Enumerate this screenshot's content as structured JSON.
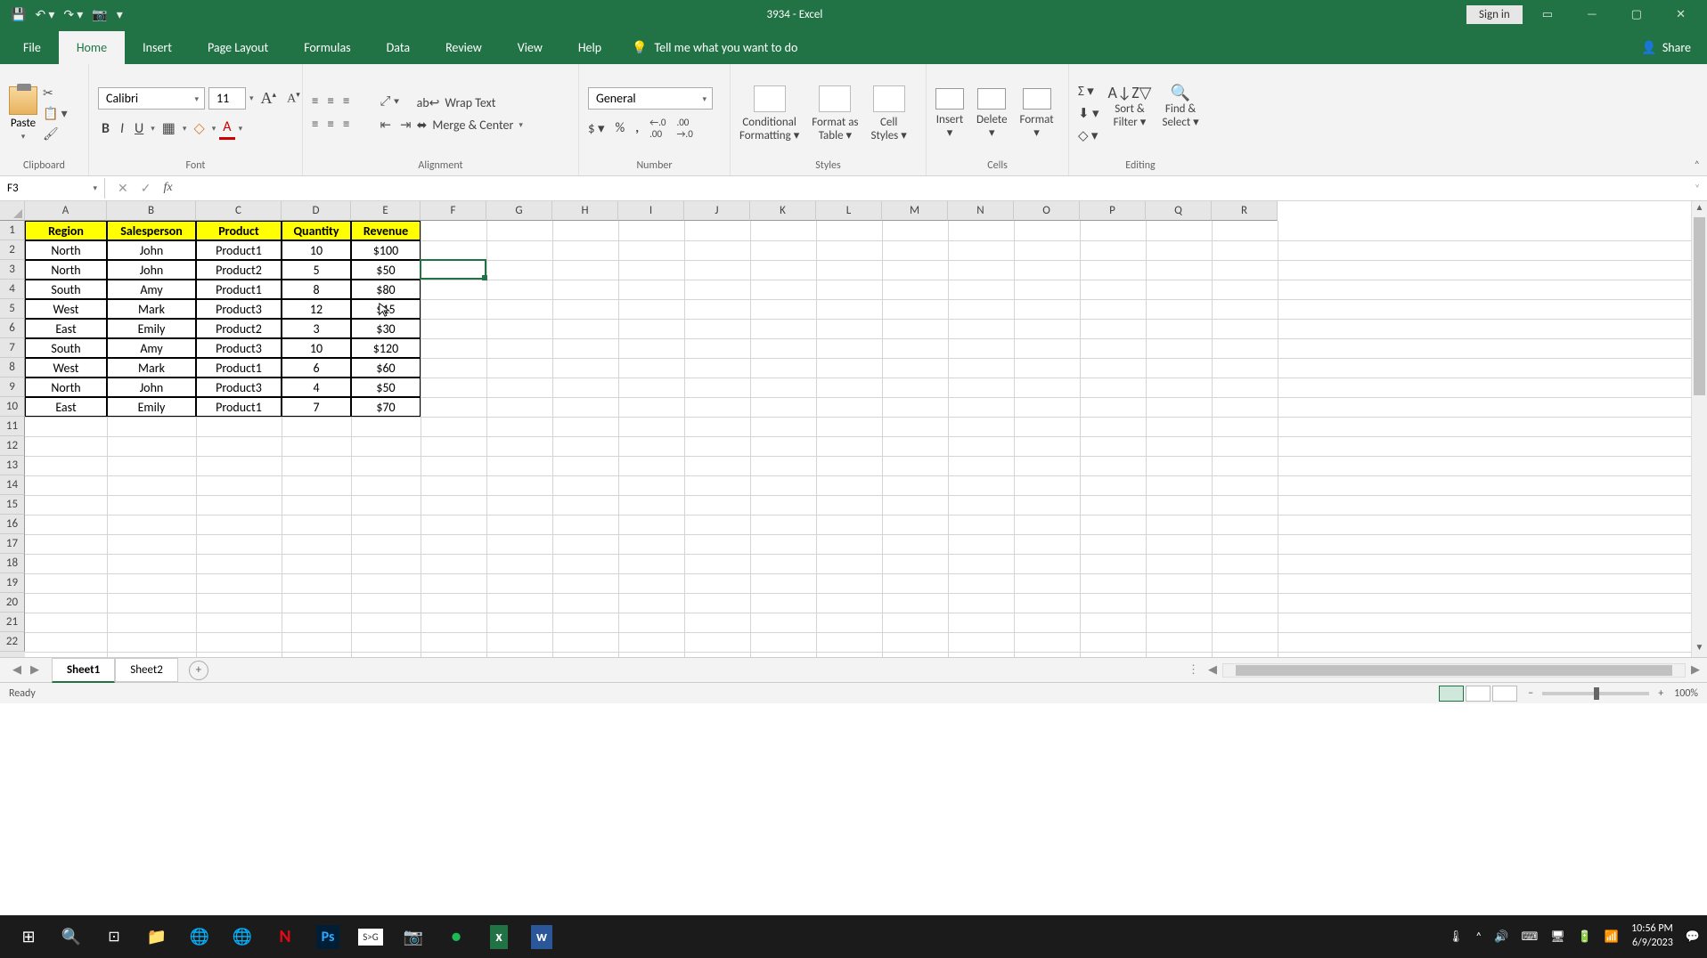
{
  "app": {
    "title": "3934  -  Excel",
    "signin": "Sign in"
  },
  "tabs": {
    "file": "File",
    "list": [
      "Home",
      "Insert",
      "Page Layout",
      "Formulas",
      "Data",
      "Review",
      "View",
      "Help"
    ],
    "active": "Home",
    "tellme": "Tell me what you want to do",
    "share": "Share"
  },
  "ribbon": {
    "clipboard": {
      "label": "Clipboard",
      "paste": "Paste"
    },
    "font": {
      "label": "Font",
      "name": "Calibri",
      "size": "11"
    },
    "alignment": {
      "label": "Alignment",
      "wrap": "Wrap Text",
      "merge": "Merge & Center"
    },
    "number": {
      "label": "Number",
      "format": "General"
    },
    "styles": {
      "label": "Styles",
      "cond1": "Conditional",
      "cond2": "Formatting",
      "fat1": "Format as",
      "fat2": "Table",
      "cell1": "Cell",
      "cell2": "Styles"
    },
    "cells": {
      "label": "Cells",
      "insert": "Insert",
      "delete": "Delete",
      "format": "Format"
    },
    "editing": {
      "label": "Editing",
      "sort1": "Sort &",
      "sort2": "Filter",
      "find1": "Find &",
      "find2": "Select"
    }
  },
  "formula_bar": {
    "namebox": "F3",
    "formula": ""
  },
  "grid": {
    "col_widths": {
      "A": 92,
      "B": 100,
      "C": 96,
      "D": 78,
      "E": 78,
      "other": 74
    },
    "columns": [
      "A",
      "B",
      "C",
      "D",
      "E",
      "F",
      "G",
      "H",
      "I",
      "J",
      "K",
      "L",
      "M",
      "N",
      "O",
      "P",
      "Q",
      "R"
    ],
    "row_count": 22,
    "headers": [
      "Region",
      "Salesperson",
      "Product",
      "Quantity",
      "Revenue"
    ],
    "rows": [
      [
        "North",
        "John",
        "Product1",
        "10",
        "$100"
      ],
      [
        "North",
        "John",
        "Product2",
        "5",
        "$50"
      ],
      [
        "South",
        "Amy",
        "Product1",
        "8",
        "$80"
      ],
      [
        "West",
        "Mark",
        "Product3",
        "12",
        "$15"
      ],
      [
        "East",
        "Emily",
        "Product2",
        "3",
        "$30"
      ],
      [
        "South",
        "Amy",
        "Product3",
        "10",
        "$120"
      ],
      [
        "West",
        "Mark",
        "Product1",
        "6",
        "$60"
      ],
      [
        "North",
        "John",
        "Product3",
        "4",
        "$50"
      ],
      [
        "East",
        "Emily",
        "Product1",
        "7",
        "$70"
      ]
    ],
    "active_cell": "F3"
  },
  "chart_data": {
    "type": "table",
    "title": "",
    "columns": [
      "Region",
      "Salesperson",
      "Product",
      "Quantity",
      "Revenue"
    ],
    "rows": [
      {
        "Region": "North",
        "Salesperson": "John",
        "Product": "Product1",
        "Quantity": 10,
        "Revenue": 100
      },
      {
        "Region": "North",
        "Salesperson": "John",
        "Product": "Product2",
        "Quantity": 5,
        "Revenue": 50
      },
      {
        "Region": "South",
        "Salesperson": "Amy",
        "Product": "Product1",
        "Quantity": 8,
        "Revenue": 80
      },
      {
        "Region": "West",
        "Salesperson": "Mark",
        "Product": "Product3",
        "Quantity": 12,
        "Revenue": 15
      },
      {
        "Region": "East",
        "Salesperson": "Emily",
        "Product": "Product2",
        "Quantity": 3,
        "Revenue": 30
      },
      {
        "Region": "South",
        "Salesperson": "Amy",
        "Product": "Product3",
        "Quantity": 10,
        "Revenue": 120
      },
      {
        "Region": "West",
        "Salesperson": "Mark",
        "Product": "Product1",
        "Quantity": 6,
        "Revenue": 60
      },
      {
        "Region": "North",
        "Salesperson": "John",
        "Product": "Product3",
        "Quantity": 4,
        "Revenue": 50
      },
      {
        "Region": "East",
        "Salesperson": "Emily",
        "Product": "Product1",
        "Quantity": 7,
        "Revenue": 70
      }
    ]
  },
  "sheets": {
    "list": [
      "Sheet1",
      "Sheet2"
    ],
    "active": "Sheet1"
  },
  "status": {
    "ready": "Ready",
    "zoom": "100%"
  },
  "taskbar": {
    "time": "10:56 PM",
    "date": "6/9/2023"
  }
}
